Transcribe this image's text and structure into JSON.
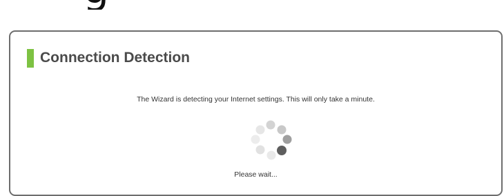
{
  "header": {
    "glyph": "g"
  },
  "panel": {
    "title": "Connection Detection",
    "accent_color": "#7dc242",
    "message": "The Wizard is detecting your Internet settings. This will only take a minute.",
    "wait_text": "Please wait...",
    "spinner_icon": "loading-spinner-icon"
  }
}
